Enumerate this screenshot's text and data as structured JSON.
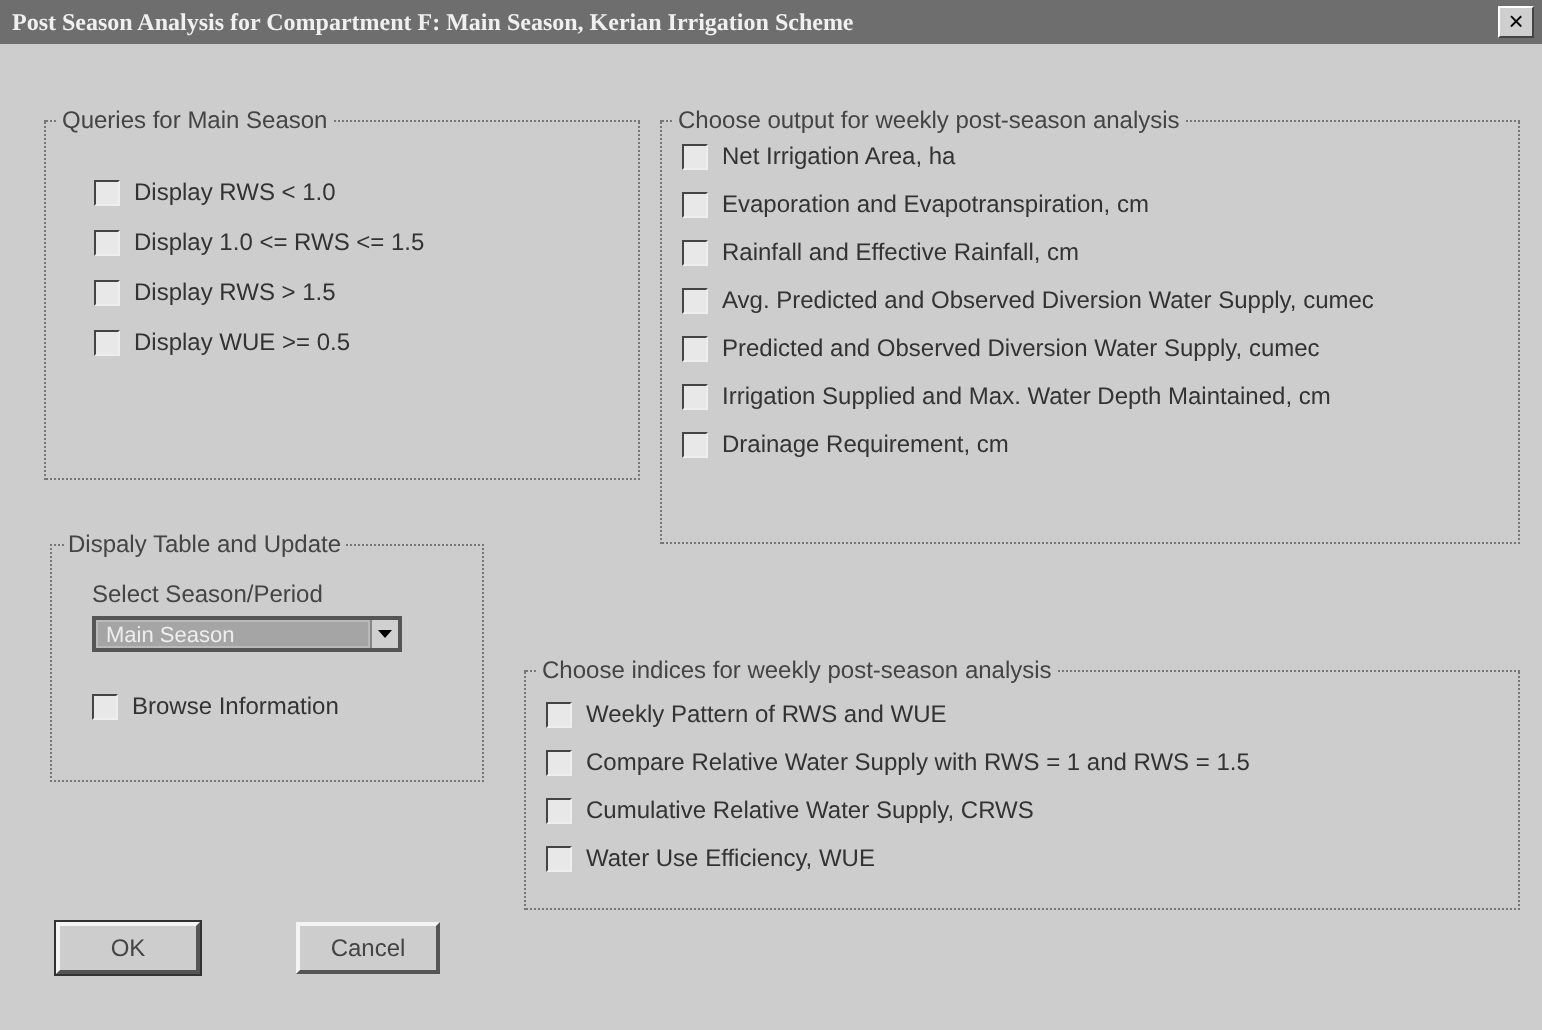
{
  "window": {
    "title": "Post Season Analysis for Compartment F: Main Season, Kerian Irrigation Scheme",
    "close": "×"
  },
  "queries": {
    "title": "Queries for Main Season",
    "items": [
      {
        "label": "Display RWS < 1.0",
        "checked": false
      },
      {
        "label": "Display 1.0 <= RWS <= 1.5",
        "checked": false
      },
      {
        "label": "Display RWS > 1.5",
        "checked": false
      },
      {
        "label": "Display WUE >= 0.5",
        "checked": false
      }
    ]
  },
  "outputs": {
    "title": "Choose output for weekly post-season analysis",
    "items": [
      {
        "label": "Net Irrigation Area, ha",
        "checked": false
      },
      {
        "label": "Evaporation and Evapotranspiration, cm",
        "checked": false
      },
      {
        "label": "Rainfall and Effective Rainfall, cm",
        "checked": false
      },
      {
        "label": "Avg. Predicted and Observed Diversion Water Supply, cumec",
        "checked": false
      },
      {
        "label": "Predicted and Observed Diversion Water Supply, cumec",
        "checked": false
      },
      {
        "label": "Irrigation Supplied and Max. Water Depth Maintained, cm",
        "checked": false
      },
      {
        "label": "Drainage Requirement, cm",
        "checked": false
      }
    ]
  },
  "display": {
    "title": "Dispaly Table and Update",
    "select_label": "Select Season/Period",
    "select": {
      "value": "Main Season",
      "disabled": true
    },
    "browse": {
      "label": "Browse Information",
      "checked": false
    }
  },
  "indices": {
    "title": "Choose indices for weekly post-season analysis",
    "items": [
      {
        "label": "Weekly Pattern of RWS and WUE",
        "checked": false
      },
      {
        "label": "Compare Relative Water Supply with RWS = 1 and RWS = 1.5",
        "checked": false
      },
      {
        "label": "Cumulative Relative Water Supply, CRWS",
        "checked": false
      },
      {
        "label": "Water Use Efficiency, WUE",
        "checked": false
      }
    ]
  },
  "buttons": [
    {
      "label": "OK",
      "default": true
    },
    {
      "label": "Cancel",
      "default": false
    }
  ]
}
